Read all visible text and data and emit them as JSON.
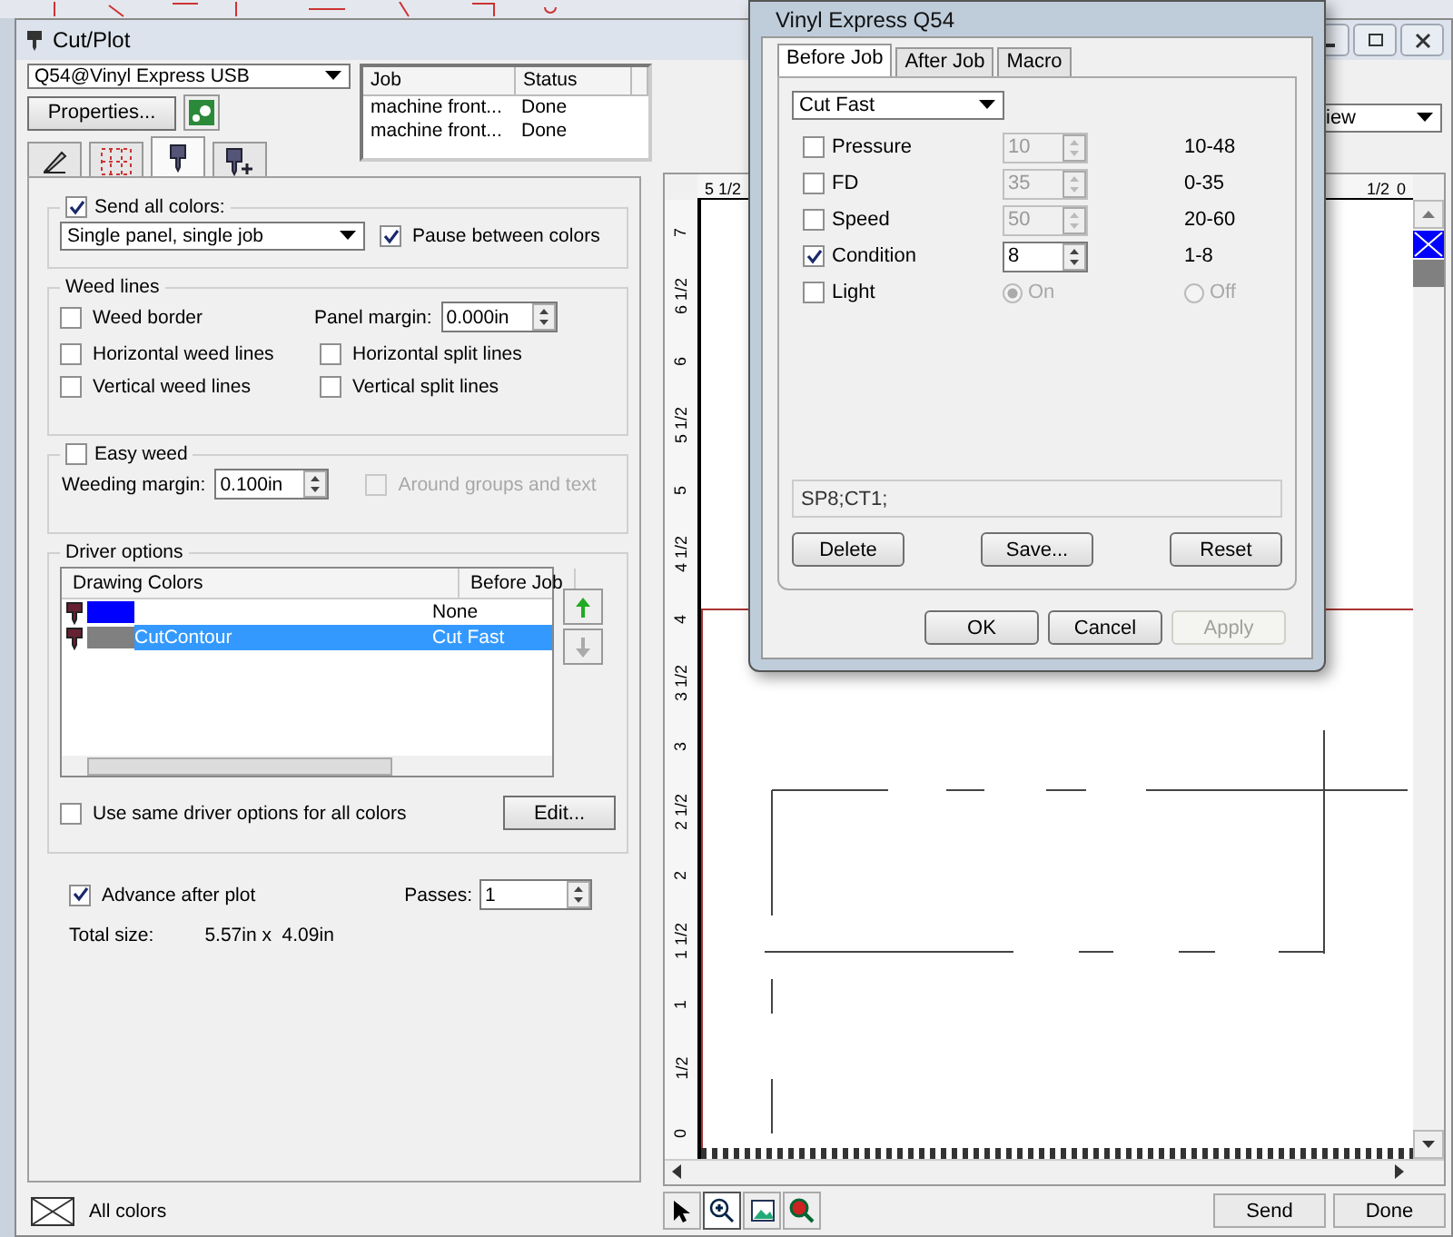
{
  "window": {
    "title": "Cut/Plot"
  },
  "printer": {
    "value": "Q54@Vinyl Express USB"
  },
  "properties_button": "Properties...",
  "job_table": {
    "columns": [
      "Job",
      "Status"
    ],
    "rows": [
      {
        "job": "machine front...",
        "status": "Done"
      },
      {
        "job": "machine front...",
        "status": "Done"
      }
    ]
  },
  "panel_tabs": [
    {
      "kind": "page",
      "selected": false
    },
    {
      "kind": "grid",
      "selected": false
    },
    {
      "kind": "cutter",
      "selected": true
    },
    {
      "kind": "cutter-plus",
      "selected": false
    }
  ],
  "send_all_colors": {
    "label": "Send all colors:",
    "checked": true
  },
  "output_mode": {
    "value": "Single panel, single job"
  },
  "pause_between_colors": {
    "label": "Pause between colors",
    "checked": true
  },
  "weed_lines": {
    "title": "Weed lines",
    "left": [
      {
        "label": "Weed border",
        "checked": false
      },
      {
        "label": "Horizontal weed lines",
        "checked": false
      },
      {
        "label": "Vertical weed lines",
        "checked": false
      }
    ],
    "panel_margin": {
      "label": "Panel margin:",
      "value": "0.000in"
    },
    "right": [
      {
        "label": "Horizontal split lines",
        "checked": false
      },
      {
        "label": "Vertical split lines",
        "checked": false
      }
    ]
  },
  "easy_weed": {
    "label": "Easy weed",
    "checked": false,
    "weeding_margin": {
      "label": "Weeding margin:",
      "value": "0.100in"
    },
    "around_groups": {
      "label": "Around groups and text",
      "checked": false,
      "disabled": true
    }
  },
  "driver_options": {
    "title": "Driver options",
    "columns": [
      "Drawing Colors",
      "Before Job"
    ],
    "rows": [
      {
        "color": "#0000ff",
        "name": "",
        "before_job": "None",
        "selected": false
      },
      {
        "color": "#808080",
        "name": "CutContour",
        "before_job": "Cut Fast",
        "selected": true
      }
    ],
    "same_options": {
      "label": "Use same driver options for all colors",
      "checked": false
    },
    "edit_button": "Edit..."
  },
  "advance_after_plot": {
    "label": "Advance after plot",
    "checked": true
  },
  "passes": {
    "label": "Passes:",
    "value": "1"
  },
  "total_size": {
    "label": "Total size:",
    "value": "5.57in x  4.09in"
  },
  "status": {
    "label": "All colors"
  },
  "preview": {
    "view_select": "iew",
    "top_ruler": [
      "5 1/2",
      "1/2",
      "0"
    ],
    "side_ruler": [
      "7",
      "6 1/2",
      "6",
      "5 1/2",
      "5",
      "4 1/2",
      "4",
      "3 1/2",
      "3",
      "2 1/2",
      "2",
      "1 1/2",
      "1",
      "1/2",
      "0"
    ],
    "swatches": [
      {
        "color": "#0000ff",
        "selected": true
      },
      {
        "color": "#808080",
        "selected": false
      }
    ]
  },
  "tools": [
    {
      "kind": "pointer",
      "selected": false
    },
    {
      "kind": "zoom",
      "selected": true
    },
    {
      "kind": "image",
      "selected": false
    },
    {
      "kind": "zoom-color",
      "selected": false
    }
  ],
  "actions": [
    "Send",
    "Done"
  ],
  "dialog": {
    "title": "Vinyl Express Q54",
    "tabs": [
      {
        "label": "Before Job",
        "selected": true
      },
      {
        "label": "After Job",
        "selected": false
      },
      {
        "label": "Macro",
        "selected": false
      }
    ],
    "preset": "Cut Fast",
    "params": [
      {
        "kind": "spin",
        "label": "Pressure",
        "checked": false,
        "value": "10",
        "range": "10-48"
      },
      {
        "kind": "spin",
        "label": "FD",
        "checked": false,
        "value": "35",
        "range": "0-35"
      },
      {
        "kind": "spin",
        "label": "Speed",
        "checked": false,
        "value": "50",
        "range": "20-60"
      },
      {
        "kind": "spin",
        "label": "Condition",
        "checked": true,
        "value": "8",
        "range": "1-8"
      },
      {
        "kind": "radio",
        "label": "Light",
        "checked": false,
        "options": [
          {
            "label": "On",
            "selected": true
          },
          {
            "label": "Off",
            "selected": false
          }
        ]
      }
    ],
    "command": "SP8;CT1;",
    "buttons": [
      "Delete",
      "Save...",
      "Reset"
    ],
    "footer_buttons": [
      {
        "label": "OK",
        "disabled": false
      },
      {
        "label": "Cancel",
        "disabled": false
      },
      {
        "label": "Apply",
        "disabled": true
      }
    ]
  }
}
